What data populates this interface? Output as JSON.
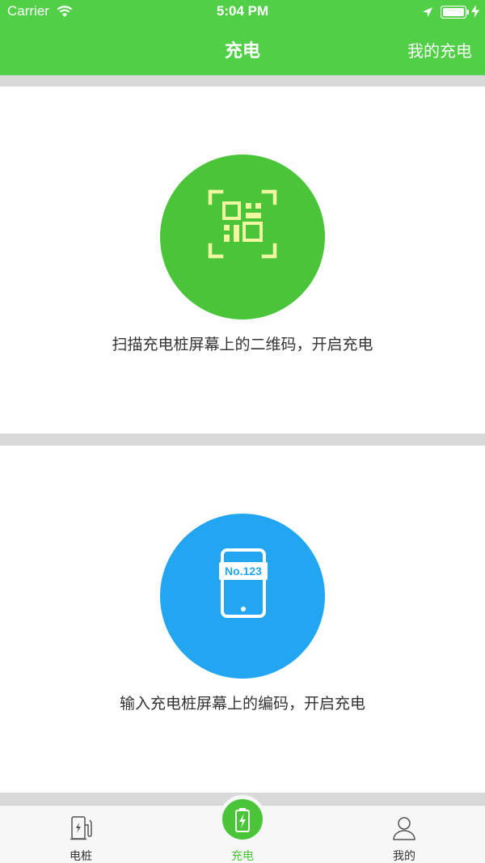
{
  "status_bar": {
    "carrier": "Carrier",
    "time": "5:04 PM"
  },
  "nav": {
    "title": "充电",
    "right_button": "我的充电"
  },
  "options": [
    {
      "caption": "扫描充电桩屏幕上的二维码，开启充电",
      "icon": "qr-scan-icon",
      "color": "#4ac53a"
    },
    {
      "caption": "输入充电桩屏幕上的编码，开启充电",
      "icon": "phone-code-icon",
      "color": "#22a6f2",
      "badge": "No.123"
    }
  ],
  "tabs": [
    {
      "label": "电桩",
      "icon": "charging-pile-icon"
    },
    {
      "label": "充电",
      "icon": "battery-charge-icon",
      "active": true
    },
    {
      "label": "我的",
      "icon": "user-icon"
    }
  ],
  "colors": {
    "accent": "#51cf47",
    "blue": "#22a6f2",
    "divider": "#d9d9d9"
  }
}
